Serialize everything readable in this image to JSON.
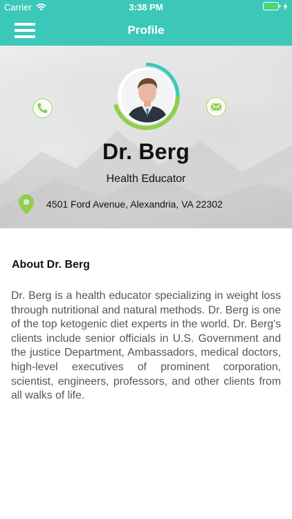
{
  "status_bar": {
    "carrier": "Carrier",
    "time": "3:38 PM"
  },
  "nav": {
    "title": "Profile",
    "menu_icon": "hamburger-menu-icon"
  },
  "profile": {
    "name": "Dr. Berg",
    "title": "Health Educator",
    "address": "4501 Ford Avenue, Alexandria, VA 22302",
    "call_icon": "phone-icon",
    "mail_icon": "envelope-icon",
    "location_icon": "map-pin-icon"
  },
  "about": {
    "heading": "About Dr. Berg",
    "body": "Dr. Berg is a health educator specializing in weight loss through nutritional and natural methods. Dr. Berg is one of the top ketogenic diet experts in the world. Dr. Berg's clients include senior officials in U.S. Government and the justice Department, Ambassadors, medical doctors, high-level executives of prominent corporation, scientist, engineers, professors, and other clients from all walks of life."
  },
  "colors": {
    "teal": "#3cc8b9",
    "green": "#8fcf4a",
    "battery": "#4cd964"
  }
}
